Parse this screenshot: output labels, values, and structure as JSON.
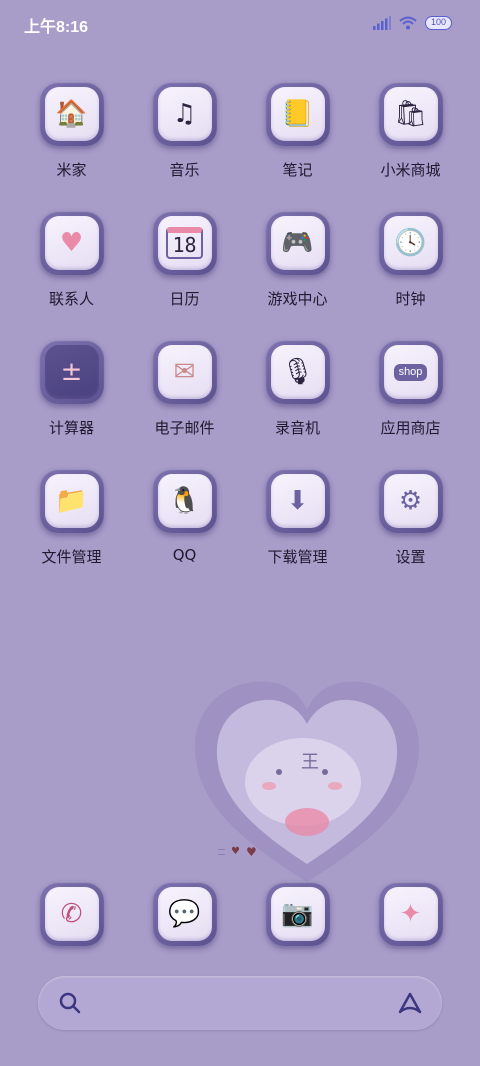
{
  "status_bar": {
    "time": "上午8:16",
    "battery": "100",
    "icons": [
      "signal-icon",
      "wifi-icon",
      "battery-icon"
    ]
  },
  "apps": [
    {
      "label": "米家",
      "icon": "mijia-icon",
      "glyph": "🏠"
    },
    {
      "label": "音乐",
      "icon": "music-icon",
      "glyph": "♫"
    },
    {
      "label": "笔记",
      "icon": "notes-icon",
      "glyph": "📒"
    },
    {
      "label": "小米商城",
      "icon": "mi-store-icon",
      "glyph": "🛍"
    },
    {
      "label": "联系人",
      "icon": "contacts-icon",
      "glyph": "♥"
    },
    {
      "label": "日历",
      "icon": "calendar-icon",
      "glyph": "18"
    },
    {
      "label": "游戏中心",
      "icon": "game-center-icon",
      "glyph": "🎮"
    },
    {
      "label": "时钟",
      "icon": "clock-icon",
      "glyph": "🕓"
    },
    {
      "label": "计算器",
      "icon": "calculator-icon",
      "glyph": "±"
    },
    {
      "label": "电子邮件",
      "icon": "email-icon",
      "glyph": "✉"
    },
    {
      "label": "录音机",
      "icon": "recorder-icon",
      "glyph": "🎙"
    },
    {
      "label": "应用商店",
      "icon": "app-store-icon",
      "glyph": "shop"
    },
    {
      "label": "文件管理",
      "icon": "file-manager-icon",
      "glyph": "📁"
    },
    {
      "label": "QQ",
      "icon": "qq-icon",
      "glyph": "🐧"
    },
    {
      "label": "下载管理",
      "icon": "download-manager-icon",
      "glyph": "⬇"
    },
    {
      "label": "设置",
      "icon": "settings-icon",
      "glyph": "⚙"
    }
  ],
  "dock": [
    {
      "icon": "phone-icon",
      "glyph": "✆"
    },
    {
      "icon": "messages-icon",
      "glyph": "💬"
    },
    {
      "icon": "camera-icon",
      "glyph": "📷"
    },
    {
      "icon": "gallery-icon",
      "glyph": "✦"
    }
  ],
  "widget": {
    "icon": "heart-photo-widget-icon",
    "character_text": "王"
  },
  "colors": {
    "wallpaper": "#a89cc9",
    "icon_frame": "#6c62a0",
    "icon_face": "#f2edf9",
    "accent_pink": "#e98aa8",
    "search_bar": "#b3a8d3",
    "status_blue": "#5a5fd0"
  }
}
